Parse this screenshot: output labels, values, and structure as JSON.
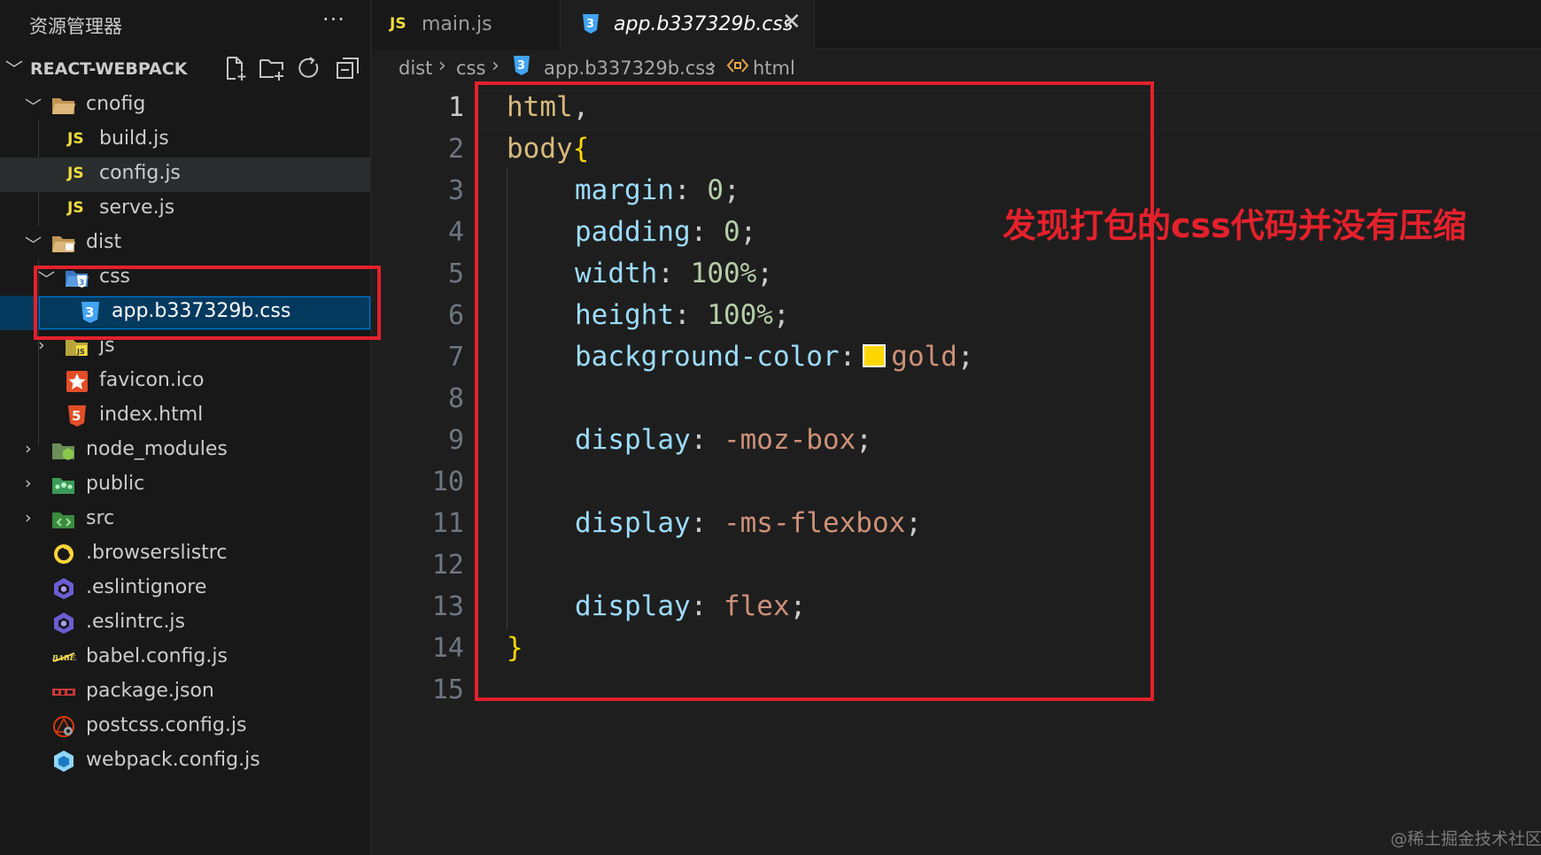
{
  "explorer": {
    "title": "资源管理器",
    "more": "···",
    "project": "REACT-WEBPACK",
    "toolbar_icons": [
      "new-file-icon",
      "new-folder-icon",
      "refresh-icon",
      "collapse-all-icon"
    ],
    "tree": [
      {
        "name": "cnofig",
        "type": "folder",
        "expanded": true
      },
      {
        "name": "build.js",
        "type": "js",
        "icon_label": "JS"
      },
      {
        "name": "config.js",
        "type": "js",
        "icon_label": "JS"
      },
      {
        "name": "serve.js",
        "type": "js",
        "icon_label": "JS"
      },
      {
        "name": "dist",
        "type": "folder",
        "expanded": true
      },
      {
        "name": "css",
        "type": "folder",
        "expanded": true
      },
      {
        "name": "app.b337329b.css",
        "type": "css",
        "selected": true
      },
      {
        "name": "js",
        "type": "folder",
        "expanded": false
      },
      {
        "name": "favicon.ico",
        "type": "ico"
      },
      {
        "name": "index.html",
        "type": "html"
      },
      {
        "name": "node_modules",
        "type": "folder",
        "expanded": false
      },
      {
        "name": "public",
        "type": "folder",
        "expanded": false
      },
      {
        "name": "src",
        "type": "folder",
        "expanded": false
      },
      {
        "name": ".browserslistrc",
        "type": "browserslist"
      },
      {
        "name": ".eslintignore",
        "type": "eslint"
      },
      {
        "name": ".eslintrc.js",
        "type": "eslint"
      },
      {
        "name": "babel.config.js",
        "type": "babel"
      },
      {
        "name": "package.json",
        "type": "npm"
      },
      {
        "name": "postcss.config.js",
        "type": "postcss"
      },
      {
        "name": "webpack.config.js",
        "type": "webpack"
      }
    ]
  },
  "tabs": [
    {
      "icon_label": "JS",
      "label": "main.js",
      "active": false
    },
    {
      "label": "app.b337329b.css",
      "active": true,
      "close": "✕"
    }
  ],
  "breadcrumb": [
    "dist",
    "css",
    "app.b337329b.css",
    "html"
  ],
  "editor": {
    "line_numbers": [
      "1",
      "2",
      "3",
      "4",
      "5",
      "6",
      "7",
      "8",
      "9",
      "10",
      "11",
      "12",
      "13",
      "14",
      "15"
    ],
    "lines": {
      "l1_sel": "html",
      "l1_punc": ",",
      "l2_sel": "body",
      "l2_brace": "{",
      "l3_prop": "margin",
      "l3_num": "0",
      "l4_prop": "padding",
      "l4_num": "0",
      "l5_prop": "width",
      "l5_num": "100%",
      "l6_prop": "height",
      "l6_num": "100%",
      "l7_prop": "background-color",
      "l7_val": "gold",
      "l9_prop": "display",
      "l9_val": "-moz-box",
      "l11_prop": "display",
      "l11_val": "-ms-flexbox",
      "l13_prop": "display",
      "l13_val": "flex",
      "l14_brace": "}"
    },
    "swatch_color": "#ffd700"
  },
  "annotation": {
    "text": "发现打包的css代码并没有压缩",
    "color": "#e5212c"
  },
  "watermark": "@稀土掘金技术社区"
}
